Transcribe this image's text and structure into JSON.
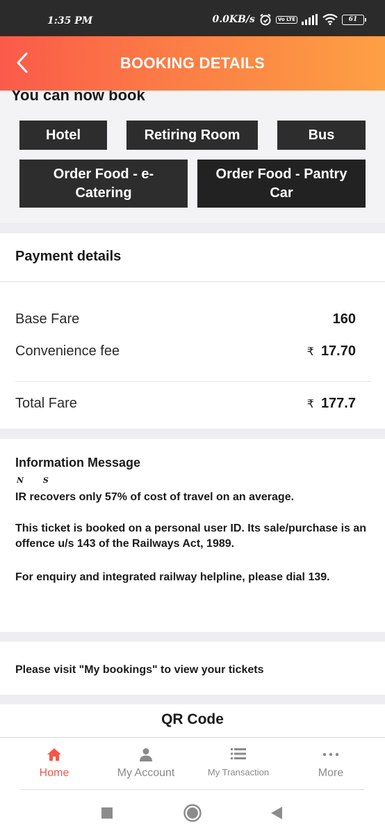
{
  "status_bar": {
    "time": "1:35 PM",
    "network_speed": "0.0KB/s",
    "volte": "Vo LTE",
    "battery": "61"
  },
  "app_bar": {
    "title": "BOOKING DETAILS",
    "back_icon": "chevron-left-icon"
  },
  "book_section": {
    "heading": "You can now book",
    "buttons": [
      "Hotel",
      "Retiring Room",
      "Bus",
      "Order Food - e-Catering",
      "Order Food - Pantry Car"
    ]
  },
  "payment": {
    "title": "Payment details",
    "base_fare_label": "Base Fare",
    "base_fare_value": "160",
    "convenience_label": "Convenience fee",
    "convenience_value": "17.70",
    "total_label": "Total Fare",
    "total_value": "177.7",
    "currency_symbol": "₹"
  },
  "info": {
    "title": "Information Message",
    "ns": "N S",
    "line1": "IR recovers only 57% of cost of travel on an average.",
    "line2": "This ticket is booked on a personal user ID. Its sale/purchase is an offence u/s 143 of the Railways Act, 1989.",
    "line3": "For enquiry and integrated railway helpline, please dial 139."
  },
  "visit": {
    "text": "Please visit \"My bookings\" to view your tickets"
  },
  "qr": {
    "title": "QR Code"
  },
  "bottom_nav": {
    "items": [
      {
        "label": "Home",
        "icon": "home-icon",
        "active": true
      },
      {
        "label": "My Account",
        "icon": "account-icon",
        "active": false
      },
      {
        "label": "My Transaction",
        "icon": "list-icon",
        "active": false
      },
      {
        "label": "More",
        "icon": "more-icon",
        "active": false
      }
    ]
  },
  "colors": {
    "accent": "#f0584a",
    "header_start": "#fb5a4a",
    "header_end": "#fda044",
    "button_bg": "#2d2d2d"
  }
}
